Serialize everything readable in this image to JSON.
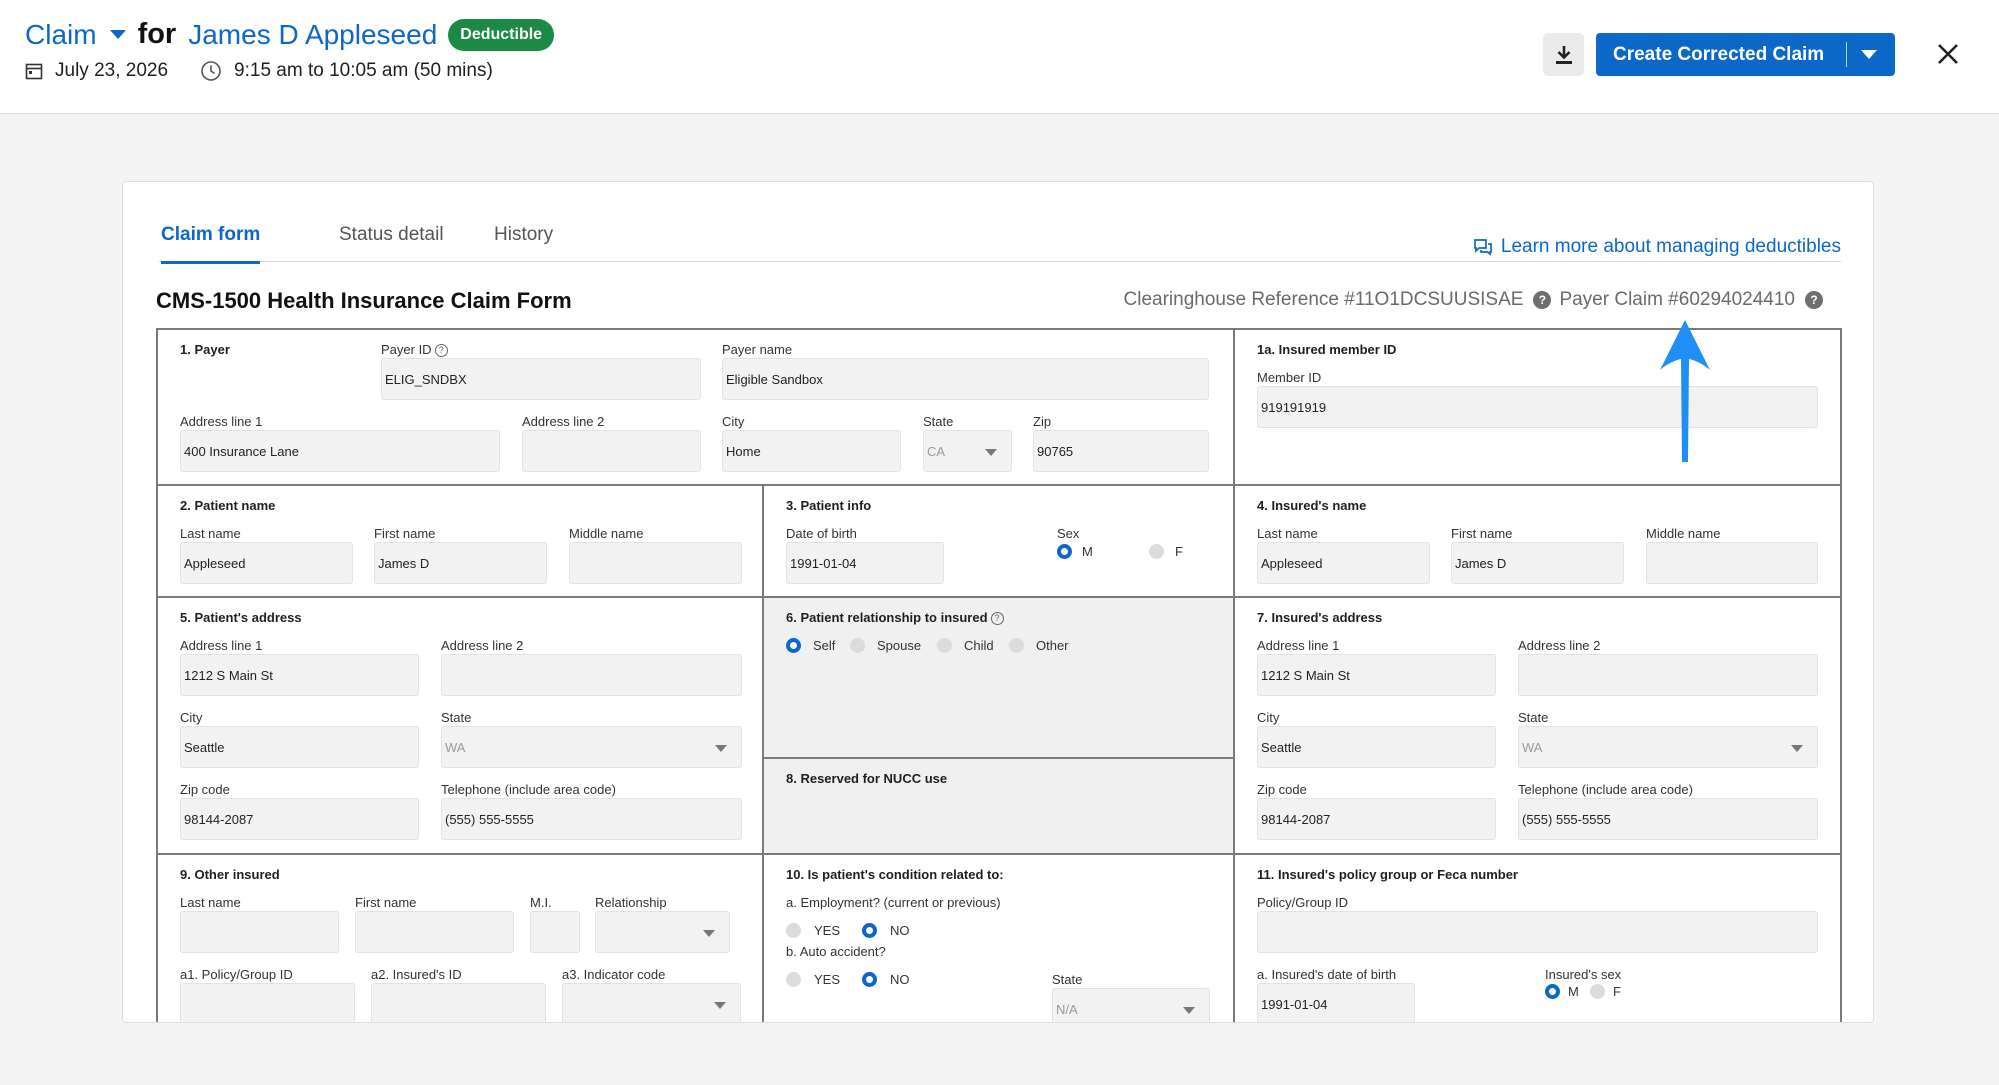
{
  "header": {
    "claim_label": "Claim",
    "for_label": "for",
    "patient_name": "James D Appleseed",
    "badge": "Deductible",
    "date": "July 23, 2026",
    "time": "9:15 am to 10:05 am (50 mins)",
    "create_button": "Create Corrected Claim"
  },
  "tabs": [
    "Claim form",
    "Status detail",
    "History"
  ],
  "learn_link": "Learn more about managing deductibles",
  "form": {
    "title": "CMS-1500 Health Insurance Claim Form",
    "clearinghouse_ref": "Clearinghouse Reference #11O1DCSUUSISAE",
    "payer_claim": "Payer Claim #60294024410",
    "payer": {
      "section": "1. Payer",
      "payer_id_label": "Payer ID",
      "payer_id": "ELIG_SNDBX",
      "payer_name_label": "Payer name",
      "payer_name": "Eligible Sandbox",
      "addr1_label": "Address line 1",
      "addr1": "400 Insurance Lane",
      "addr2_label": "Address line 2",
      "city_label": "City",
      "city": "Home",
      "state_label": "State",
      "state": "CA",
      "zip_label": "Zip",
      "zip": "90765"
    },
    "insured_id": {
      "section": "1a. Insured member ID",
      "member_id_label": "Member ID",
      "member_id": "919191919"
    },
    "patient_name": {
      "section": "2. Patient name",
      "last_label": "Last name",
      "last": "Appleseed",
      "first_label": "First name",
      "first": "James D",
      "middle_label": "Middle name"
    },
    "patient_info": {
      "section": "3. Patient info",
      "dob_label": "Date of birth",
      "dob": "1991-01-04",
      "sex_label": "Sex",
      "m": "M",
      "f": "F"
    },
    "insured_name": {
      "section": "4. Insured's name",
      "last_label": "Last name",
      "last": "Appleseed",
      "first_label": "First name",
      "first": "James D",
      "middle_label": "Middle name"
    },
    "patient_address": {
      "section": "5. Patient's address",
      "addr1_label": "Address line 1",
      "addr1": "1212 S Main St",
      "addr2_label": "Address line 2",
      "city_label": "City",
      "city": "Seattle",
      "state_label": "State",
      "state": "WA",
      "zip_label": "Zip code",
      "zip": "98144-2087",
      "phone_label": "Telephone (include area code)",
      "phone": "(555) 555-5555"
    },
    "relationship": {
      "section": "6. Patient relationship to insured",
      "self": "Self",
      "spouse": "Spouse",
      "child": "Child",
      "other": "Other"
    },
    "insured_address": {
      "section": "7. Insured's address",
      "addr1_label": "Address line 1",
      "addr1": "1212 S Main St",
      "addr2_label": "Address line 2",
      "city_label": "City",
      "city": "Seattle",
      "state_label": "State",
      "state": "WA",
      "zip_label": "Zip code",
      "zip": "98144-2087",
      "phone_label": "Telephone (include area code)",
      "phone": "(555) 555-5555"
    },
    "nucc": {
      "section": "8. Reserved for NUCC use"
    },
    "other_insured": {
      "section": "9. Other insured",
      "last_label": "Last name",
      "first_label": "First name",
      "mi_label": "M.I.",
      "relationship_label": "Relationship",
      "a1_label": "a1. Policy/Group ID",
      "a2_label": "a2. Insured's ID",
      "a3_label": "a3. Indicator code"
    },
    "condition": {
      "section": "10. Is patient's condition related to:",
      "employment_label": "a. Employment? (current or previous)",
      "auto_label": "b. Auto accident?",
      "yes": "YES",
      "no": "NO",
      "state_label": "State",
      "state": "N/A"
    },
    "policy_group": {
      "section": "11. Insured's policy group or Feca number",
      "policy_label": "Policy/Group ID",
      "dob_label": "a. Insured's date of birth",
      "dob": "1991-01-04",
      "sex_label": "Insured's sex",
      "m": "M",
      "f": "F"
    }
  }
}
